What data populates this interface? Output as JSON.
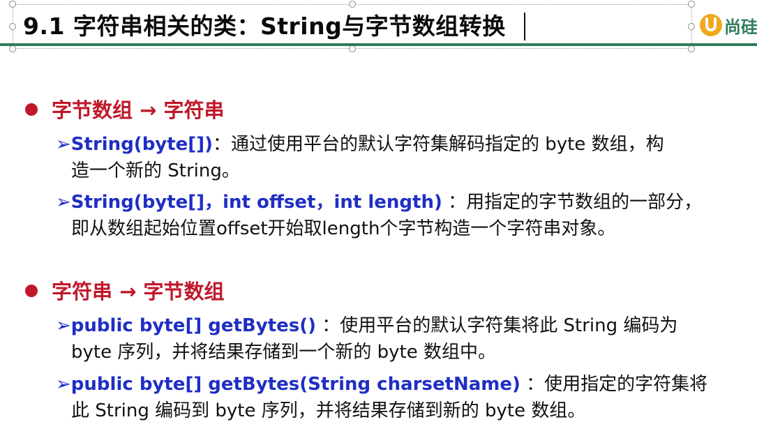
{
  "title": {
    "text": "9.1 字符串相关的类：String与字节数组转换"
  },
  "logo": {
    "mark": "U",
    "text": "尚硅"
  },
  "sections": [
    {
      "heading": "字节数组 → 字符串",
      "entries": [
        {
          "signature": "String(byte[])",
          "line1": "：通过使用平台的默认字符集解码指定的 byte 数组，构",
          "line2": "造一个新的 String。"
        },
        {
          "signature": "String(byte[]，int offset，int length)",
          "line1": " ：用指定的字节数组的一部分，",
          "line2": "即从数组起始位置offset开始取length个字节构造一个字符串对象。"
        }
      ]
    },
    {
      "heading": "字符串 → 字节数组",
      "entries": [
        {
          "signature": "public byte[] getBytes()",
          "line1": " ：使用平台的默认字符集将此 String 编码为",
          "line2": "byte 序列，并将结果存储到一个新的 byte 数组中。"
        },
        {
          "signature": "public byte[] getBytes(String charsetName)",
          "line1": " ：使用指定的字符集将",
          "line2": "此 String 编码到 byte 序列，并将结果存储到新的 byte 数组。"
        }
      ]
    }
  ],
  "bullet_arrow": "➢",
  "colors": {
    "heading": "#c0182b",
    "signature": "#1f2ec4",
    "rule": "#2e7d5b",
    "logo_mark": "#f2a81d"
  }
}
